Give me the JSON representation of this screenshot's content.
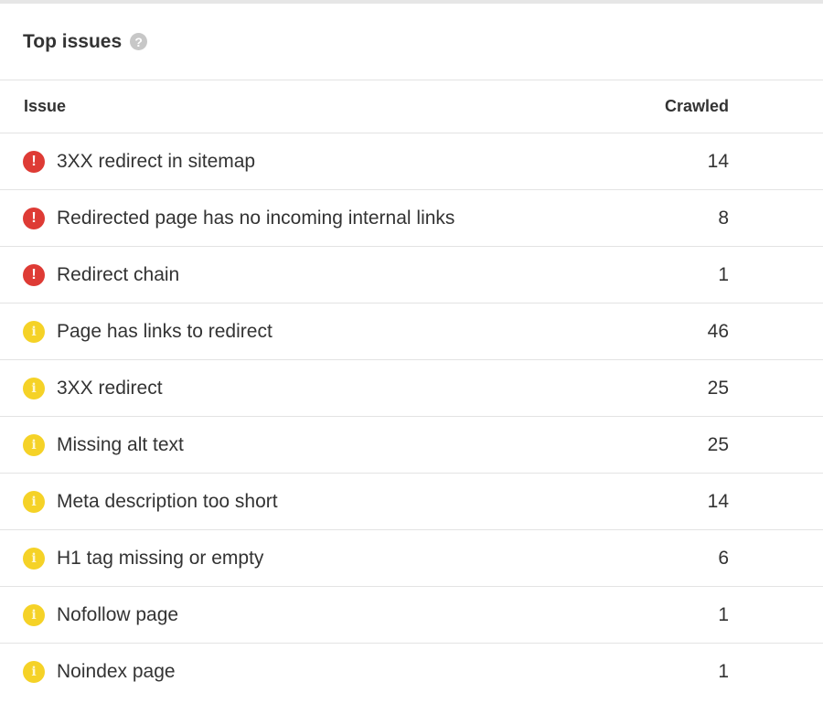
{
  "panel": {
    "title": "Top issues",
    "help_icon": "?"
  },
  "table": {
    "headers": {
      "issue": "Issue",
      "crawled": "Crawled"
    },
    "rows": [
      {
        "severity": "error",
        "icon": "!",
        "label": "3XX redirect in sitemap",
        "crawled": "14"
      },
      {
        "severity": "error",
        "icon": "!",
        "label": "Redirected page has no incoming internal links",
        "crawled": "8"
      },
      {
        "severity": "error",
        "icon": "!",
        "label": "Redirect chain",
        "crawled": "1"
      },
      {
        "severity": "warning",
        "icon": "i",
        "label": "Page has links to redirect",
        "crawled": "46"
      },
      {
        "severity": "warning",
        "icon": "i",
        "label": "3XX redirect",
        "crawled": "25"
      },
      {
        "severity": "warning",
        "icon": "i",
        "label": "Missing alt text",
        "crawled": "25"
      },
      {
        "severity": "warning",
        "icon": "i",
        "label": "Meta description too short",
        "crawled": "14"
      },
      {
        "severity": "warning",
        "icon": "i",
        "label": "H1 tag missing or empty",
        "crawled": "6"
      },
      {
        "severity": "warning",
        "icon": "i",
        "label": "Nofollow page",
        "crawled": "1"
      },
      {
        "severity": "warning",
        "icon": "i",
        "label": "Noindex page",
        "crawled": "1"
      }
    ]
  },
  "colors": {
    "error": "#de3b35",
    "warning": "#f5d227",
    "divider": "#e3e3e3"
  }
}
